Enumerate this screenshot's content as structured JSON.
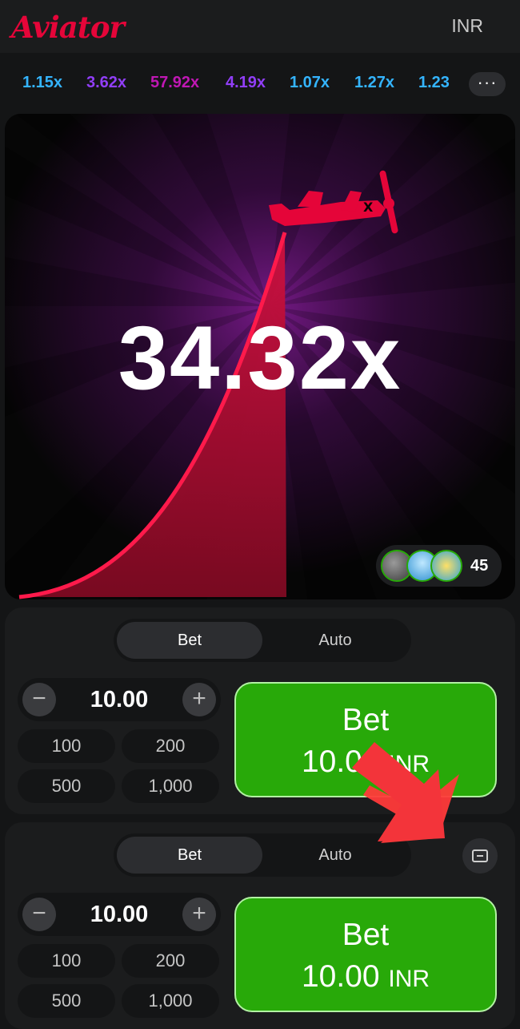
{
  "header": {
    "logo": "Aviator",
    "currency": "INR"
  },
  "history": {
    "multipliers": [
      {
        "value": "1.15x",
        "color": "#34b4ff"
      },
      {
        "value": "3.62x",
        "color": "#913ef8"
      },
      {
        "value": "57.92x",
        "color": "#c017b4"
      },
      {
        "value": "4.19x",
        "color": "#913ef8"
      },
      {
        "value": "1.07x",
        "color": "#34b4ff"
      },
      {
        "value": "1.27x",
        "color": "#34b4ff"
      },
      {
        "value": "1.23",
        "color": "#34b4ff"
      }
    ],
    "more_icon": "more-dots-icon"
  },
  "game": {
    "multiplier": "34.32x",
    "players_count": "45",
    "plane_color": "#e50539"
  },
  "panels": [
    {
      "tab_bet": "Bet",
      "tab_auto": "Auto",
      "amount": "10.00",
      "minus": "−",
      "plus": "+",
      "quick": [
        "100",
        "200",
        "500",
        "1,000"
      ],
      "bet_label": "Bet",
      "bet_amount": "10.00",
      "bet_currency": "INR"
    },
    {
      "tab_bet": "Bet",
      "tab_auto": "Auto",
      "amount": "10.00",
      "minus": "−",
      "plus": "+",
      "quick": [
        "100",
        "200",
        "500",
        "1,000"
      ],
      "bet_label": "Bet",
      "bet_amount": "10.00",
      "bet_currency": "INR"
    }
  ],
  "colors": {
    "bet_green": "#28a909",
    "accent_red": "#e50539"
  }
}
